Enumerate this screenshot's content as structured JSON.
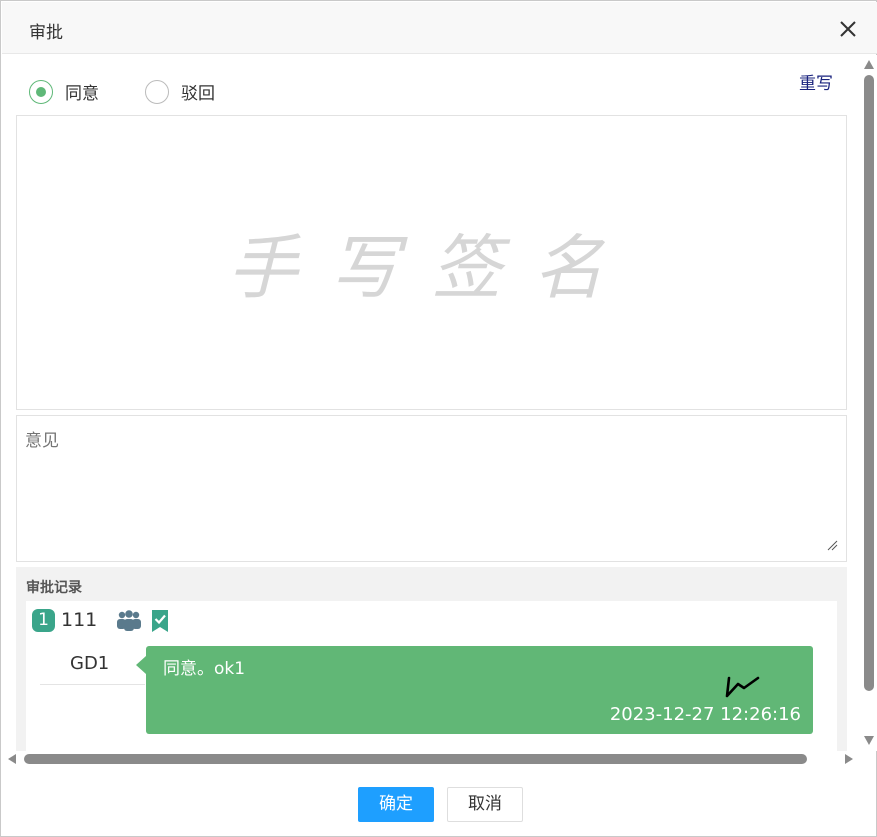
{
  "dialog": {
    "title": "审批",
    "close_icon": "close-icon"
  },
  "decision": {
    "options": [
      {
        "label": "同意",
        "checked": true
      },
      {
        "label": "驳回",
        "checked": false
      }
    ],
    "accent_color": "#5fb878"
  },
  "signature": {
    "rewrite_label": "重写",
    "placeholder": "手写签名"
  },
  "opinion": {
    "placeholder": "意见",
    "value": ""
  },
  "history": {
    "title": "审批记录",
    "steps": [
      {
        "index": "1",
        "name": "111",
        "icons": [
          "group-icon",
          "approved-icon"
        ],
        "records": [
          {
            "approver": "GD1",
            "comment": "同意。ok1",
            "time": "2023-12-27 12:26:16",
            "bubble_color": "#61b776"
          }
        ]
      }
    ]
  },
  "footer": {
    "ok_label": "确定",
    "cancel_label": "取消",
    "ok_color": "#1e9fff"
  }
}
